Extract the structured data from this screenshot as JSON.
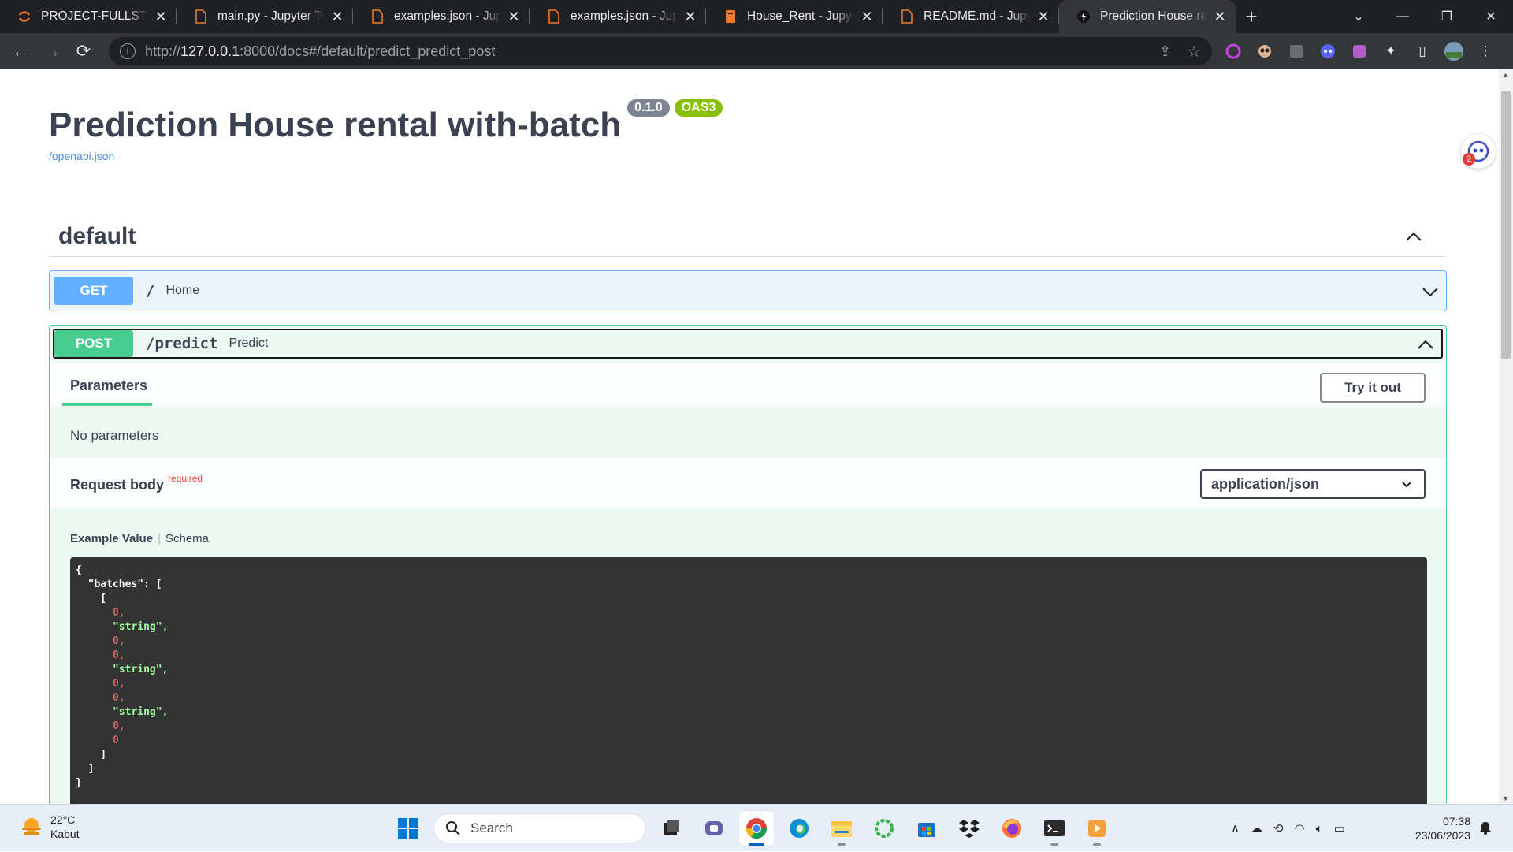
{
  "browser": {
    "tabs": [
      {
        "title": "PROJECT-FULLSTACK-",
        "icon": "jupyter-spinner-icon"
      },
      {
        "title": "main.py - Jupyter Text",
        "icon": "file-icon"
      },
      {
        "title": "examples.json - Jupyte",
        "icon": "file-icon"
      },
      {
        "title": "examples.json - Jupyte",
        "icon": "file-icon"
      },
      {
        "title": "House_Rent - Jupyter",
        "icon": "notebook-icon"
      },
      {
        "title": "README.md - Jupyter",
        "icon": "file-icon"
      },
      {
        "title": "Prediction House rent",
        "icon": "fastapi-icon",
        "active": true
      }
    ],
    "url_prefix": "http://",
    "url_host": "127.0.0.1",
    "url_rest": ":8000/docs#/default/predict_predict_post"
  },
  "api": {
    "title": "Prediction House rental with-batch",
    "version": "0.1.0",
    "oas": "OAS3",
    "openapi_link": "/openapi.json",
    "tag": "default"
  },
  "get_op": {
    "method": "GET",
    "path": "/",
    "summary": "Home"
  },
  "post_op": {
    "method": "POST",
    "path": "/predict",
    "summary": "Predict",
    "parameters_tab": "Parameters",
    "try_it_out": "Try it out",
    "no_parameters": "No parameters",
    "request_body": "Request body",
    "required": "required",
    "content_type": "application/json",
    "example_value_tab": "Example Value",
    "schema_tab": "Schema",
    "example_lines": [
      {
        "text": "{",
        "kind": "punc"
      },
      {
        "text": "  \"batches\": [",
        "kind": "punc"
      },
      {
        "text": "    [",
        "kind": "punc"
      },
      {
        "text": "      0,",
        "kind": "num"
      },
      {
        "text": "      \"string\",",
        "kind": "str"
      },
      {
        "text": "      0,",
        "kind": "num"
      },
      {
        "text": "      0,",
        "kind": "num"
      },
      {
        "text": "      \"string\",",
        "kind": "str"
      },
      {
        "text": "      0,",
        "kind": "num"
      },
      {
        "text": "      0,",
        "kind": "num"
      },
      {
        "text": "      \"string\",",
        "kind": "str"
      },
      {
        "text": "      0,",
        "kind": "num"
      },
      {
        "text": "      0",
        "kind": "num"
      },
      {
        "text": "    ]",
        "kind": "punc"
      },
      {
        "text": "  ]",
        "kind": "punc"
      },
      {
        "text": "}",
        "kind": "punc"
      }
    ]
  },
  "widget": {
    "badge_count": "2"
  },
  "taskbar": {
    "weather_temp": "22°C",
    "weather_desc": "Kabut",
    "search_placeholder": "Search",
    "time": "07:38",
    "date": "23/06/2023"
  },
  "colors": {
    "get": "#61affe",
    "post": "#49cc90",
    "version_badge": "#7d8492",
    "oas_badge": "#89bf04"
  }
}
